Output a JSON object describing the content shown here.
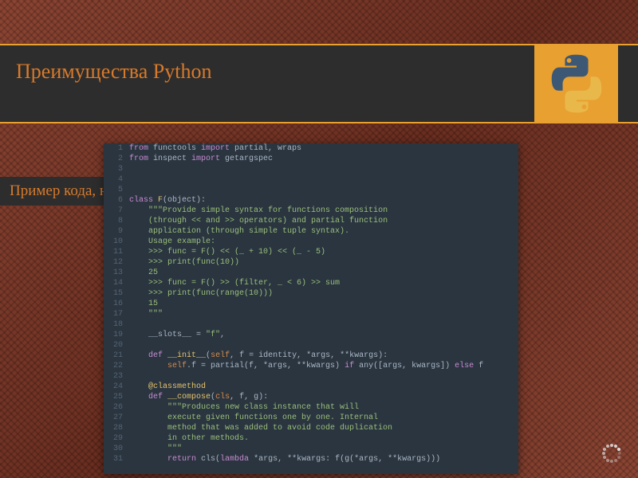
{
  "header": {
    "title": "Преимущества Python"
  },
  "subtitle": "Пример кода, написанного на Python",
  "logo": {
    "name": "python-logo"
  },
  "code": {
    "lines": [
      {
        "n": 1,
        "seg": [
          {
            "c": "kw",
            "t": "from "
          },
          {
            "c": "",
            "t": "functools "
          },
          {
            "c": "kw",
            "t": "import "
          },
          {
            "c": "",
            "t": "partial, wraps"
          }
        ]
      },
      {
        "n": 2,
        "seg": [
          {
            "c": "kw",
            "t": "from "
          },
          {
            "c": "",
            "t": "inspect "
          },
          {
            "c": "kw",
            "t": "import "
          },
          {
            "c": "",
            "t": "getargspec"
          }
        ]
      },
      {
        "n": 3,
        "seg": [
          {
            "c": "",
            "t": ""
          }
        ]
      },
      {
        "n": 4,
        "seg": [
          {
            "c": "cm",
            "t": ""
          }
        ]
      },
      {
        "n": 5,
        "seg": [
          {
            "c": "cm",
            "t": ""
          }
        ]
      },
      {
        "n": 6,
        "seg": [
          {
            "c": "kw",
            "t": "class "
          },
          {
            "c": "fn",
            "t": "F"
          },
          {
            "c": "",
            "t": "(object):"
          }
        ]
      },
      {
        "n": 7,
        "seg": [
          {
            "c": "",
            "t": "    "
          },
          {
            "c": "st",
            "t": "\"\"\"Provide simple syntax for functions composition"
          }
        ]
      },
      {
        "n": 8,
        "seg": [
          {
            "c": "",
            "t": "    "
          },
          {
            "c": "st",
            "t": "(through << and >> operators) and partial function"
          }
        ]
      },
      {
        "n": 9,
        "seg": [
          {
            "c": "",
            "t": "    "
          },
          {
            "c": "st",
            "t": "application (through simple tuple syntax)."
          }
        ]
      },
      {
        "n": 10,
        "seg": [
          {
            "c": "",
            "t": "    "
          },
          {
            "c": "st",
            "t": "Usage example:"
          }
        ]
      },
      {
        "n": 11,
        "seg": [
          {
            "c": "",
            "t": "    "
          },
          {
            "c": "st",
            "t": ">>> func = F() << (_ + 10) << (_ - 5)"
          }
        ]
      },
      {
        "n": 12,
        "seg": [
          {
            "c": "",
            "t": "    "
          },
          {
            "c": "st",
            "t": ">>> print(func(10))"
          }
        ]
      },
      {
        "n": 13,
        "seg": [
          {
            "c": "",
            "t": "    "
          },
          {
            "c": "st",
            "t": "25"
          }
        ]
      },
      {
        "n": 14,
        "seg": [
          {
            "c": "",
            "t": "    "
          },
          {
            "c": "st",
            "t": ">>> func = F() >> (filter, _ < 6) >> sum"
          }
        ]
      },
      {
        "n": 15,
        "seg": [
          {
            "c": "",
            "t": "    "
          },
          {
            "c": "st",
            "t": ">>> print(func(range(10)))"
          }
        ]
      },
      {
        "n": 16,
        "seg": [
          {
            "c": "",
            "t": "    "
          },
          {
            "c": "st",
            "t": "15"
          }
        ]
      },
      {
        "n": 17,
        "seg": [
          {
            "c": "",
            "t": "    "
          },
          {
            "c": "st",
            "t": "\"\"\""
          }
        ]
      },
      {
        "n": 18,
        "seg": [
          {
            "c": "",
            "t": ""
          }
        ]
      },
      {
        "n": 19,
        "seg": [
          {
            "c": "",
            "t": "    __slots__ = "
          },
          {
            "c": "st",
            "t": "\"f\""
          },
          {
            "c": "",
            "t": ","
          }
        ]
      },
      {
        "n": 20,
        "seg": [
          {
            "c": "",
            "t": ""
          }
        ]
      },
      {
        "n": 21,
        "seg": [
          {
            "c": "",
            "t": "    "
          },
          {
            "c": "kw",
            "t": "def "
          },
          {
            "c": "fn",
            "t": "__init__"
          },
          {
            "c": "",
            "t": "("
          },
          {
            "c": "pm",
            "t": "self"
          },
          {
            "c": "",
            "t": ", f = identity, *args, **kwargs):"
          }
        ]
      },
      {
        "n": 22,
        "seg": [
          {
            "c": "",
            "t": "        "
          },
          {
            "c": "pm",
            "t": "self"
          },
          {
            "c": "",
            "t": ".f = partial(f, *args, **kwargs) "
          },
          {
            "c": "kw",
            "t": "if "
          },
          {
            "c": "",
            "t": "any([args, kwargs]) "
          },
          {
            "c": "kw",
            "t": "else "
          },
          {
            "c": "",
            "t": "f"
          }
        ]
      },
      {
        "n": 23,
        "seg": [
          {
            "c": "",
            "t": ""
          }
        ]
      },
      {
        "n": 24,
        "seg": [
          {
            "c": "",
            "t": "    "
          },
          {
            "c": "dc",
            "t": "@classmethod"
          }
        ]
      },
      {
        "n": 25,
        "seg": [
          {
            "c": "",
            "t": "    "
          },
          {
            "c": "kw",
            "t": "def "
          },
          {
            "c": "fn",
            "t": "__compose"
          },
          {
            "c": "",
            "t": "("
          },
          {
            "c": "pm",
            "t": "cls"
          },
          {
            "c": "",
            "t": ", f, g):"
          }
        ]
      },
      {
        "n": 26,
        "seg": [
          {
            "c": "",
            "t": "        "
          },
          {
            "c": "st",
            "t": "\"\"\"Produces new class instance that will"
          }
        ]
      },
      {
        "n": 27,
        "seg": [
          {
            "c": "",
            "t": "        "
          },
          {
            "c": "st",
            "t": "execute given functions one by one. Internal"
          }
        ]
      },
      {
        "n": 28,
        "seg": [
          {
            "c": "",
            "t": "        "
          },
          {
            "c": "st",
            "t": "method that was added to avoid code duplication"
          }
        ]
      },
      {
        "n": 29,
        "seg": [
          {
            "c": "",
            "t": "        "
          },
          {
            "c": "st",
            "t": "in other methods."
          }
        ]
      },
      {
        "n": 30,
        "seg": [
          {
            "c": "",
            "t": "        "
          },
          {
            "c": "st",
            "t": "\"\"\""
          }
        ]
      },
      {
        "n": 31,
        "seg": [
          {
            "c": "",
            "t": "        "
          },
          {
            "c": "kw",
            "t": "return "
          },
          {
            "c": "",
            "t": "cls("
          },
          {
            "c": "kw",
            "t": "lambda "
          },
          {
            "c": "",
            "t": "*args, **kwargs: f(g(*args, **kwargs)))"
          }
        ]
      }
    ]
  }
}
